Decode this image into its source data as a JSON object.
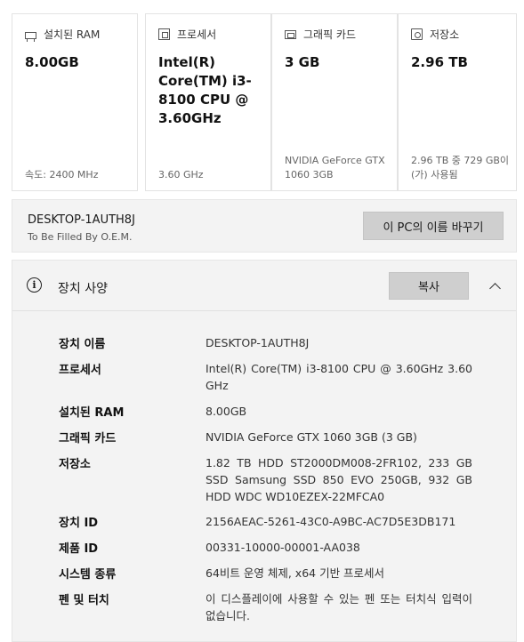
{
  "summary_cards": [
    {
      "icon": "memory-icon",
      "label": "설치된 RAM",
      "value": "8.00GB",
      "sub": "속도: 2400 MHz"
    },
    {
      "icon": "processor-icon",
      "label": "프로세서",
      "value": "Intel(R) Core(TM) i3-8100 CPU @ 3.60GHz",
      "sub": "3.60 GHz"
    },
    {
      "icon": "graphics-card-icon",
      "label": "그래픽 카드",
      "value": "3 GB",
      "sub": "NVIDIA GeForce GTX 1060 3GB"
    },
    {
      "icon": "storage-icon",
      "label": "저장소",
      "value": "2.96 TB",
      "sub": "2.96 TB 중 729 GB이(가) 사용됨"
    }
  ],
  "pc": {
    "name": "DESKTOP-1AUTH8J",
    "oem": "To Be Filled By O.E.M.",
    "rename_label": "이 PC의 이름 바꾸기"
  },
  "spec": {
    "title": "장치 사양",
    "copy_label": "복사",
    "rows": [
      {
        "key": "장치 이름",
        "value": "DESKTOP-1AUTH8J"
      },
      {
        "key": "프로세서",
        "value": "Intel(R) Core(TM) i3-8100 CPU @ 3.60GHz 3.60 GHz"
      },
      {
        "key": "설치된 RAM",
        "value": "8.00GB"
      },
      {
        "key": "그래픽 카드",
        "value": "NVIDIA GeForce GTX 1060 3GB (3 GB)"
      },
      {
        "key": "저장소",
        "value": "1.82 TB HDD ST2000DM008-2FR102, 233 GB SSD Samsung SSD 850 EVO 250GB, 932 GB HDD WDC WD10EZEX-22MFCA0"
      },
      {
        "key": "장치 ID",
        "value": "2156AEAC-5261-43C0-A9BC-AC7D5E3DB171"
      },
      {
        "key": "제품 ID",
        "value": "00331-10000-00001-AA038"
      },
      {
        "key": "시스템 종류",
        "value": "64비트 운영 체제, x64 기반 프로세서"
      },
      {
        "key": "펜 및 터치",
        "value": "이 디스플레이에 사용할 수 있는 펜 또는 터치식 입력이 없습니다."
      }
    ]
  }
}
